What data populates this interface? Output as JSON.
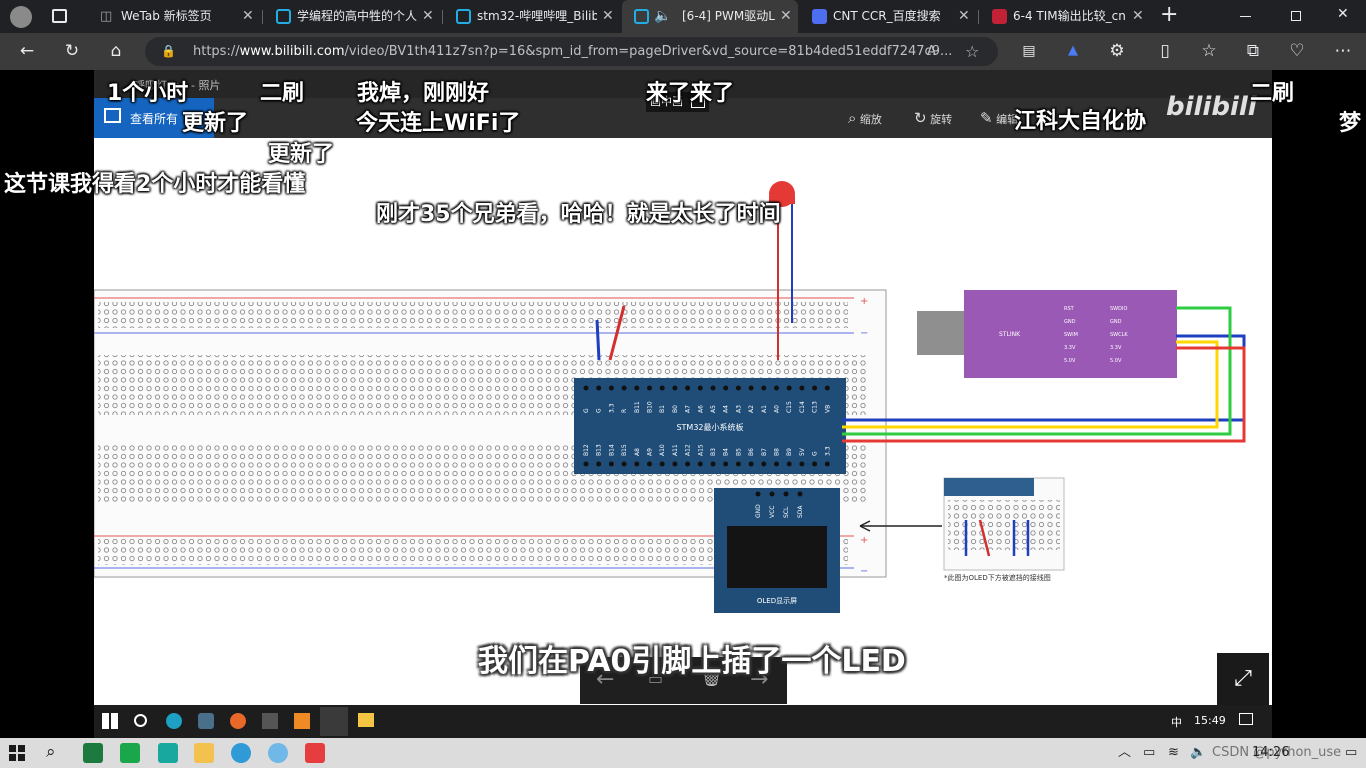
{
  "browser": {
    "tabs": [
      {
        "title": "WeTab 新标签页",
        "icon": "wetab-icon",
        "color": "#9aa0a6"
      },
      {
        "title": "学编程的高中牲的个人",
        "icon": "bilibili-tv-icon",
        "color": "#23ade5"
      },
      {
        "title": "stm32-哔哩哔哩_Bilib",
        "icon": "bilibili-tv-icon",
        "color": "#23ade5"
      },
      {
        "title": "[6-4] PWM驱动L",
        "icon": "bilibili-tv-icon",
        "color": "#23ade5"
      },
      {
        "title": "CNT CCR_百度搜索",
        "icon": "baidu-icon",
        "color": "#4e6ef2"
      },
      {
        "title": "6-4 TIM输出比较_cntc",
        "icon": "csdn-icon",
        "color": "#c32136"
      }
    ],
    "new_tab": "+",
    "url_prefix": "https://",
    "url_domain": "www.bilibili.com",
    "url_rest": "/video/BV1th411z7sn?p=16&spm_id_from=pageDriver&vd_source=81b4ded51eddf7247c9..."
  },
  "viewer": {
    "file_title": "呼吸灯.jpg - 照片",
    "view_all": "查看所有",
    "zoom": "缩放",
    "rotate": "旋转",
    "edit": "编辑",
    "pip_label": "画中画"
  },
  "danmaku": [
    "1个小时",
    "二刷",
    "我焯，刚刚好",
    "来了来了",
    "二刷",
    "更新了",
    "今天连上WiFi了",
    "江科大自化协",
    "梦",
    "更新了",
    "这节课我得看2个小时才能看懂",
    "刚才35个兄弟看，哈哈！就是太长了时间"
  ],
  "subtitle": "我们在PA0引脚上插了一个LED",
  "diagram": {
    "board_label": "STM32最小系统板",
    "oled_label": "OLED显示屏",
    "oled_pins": [
      "GND",
      "VCC",
      "SCL",
      "SDA"
    ],
    "stlink_label": "STLINK",
    "stlink_left": [
      "RST",
      "GND",
      "SWIM",
      "3.3V",
      "5.0V"
    ],
    "stlink_right": [
      "SWDIO",
      "GND",
      "SWCLK",
      "3.3V",
      "5.0V"
    ],
    "top_pins": [
      "G",
      "G",
      "3.3",
      "R",
      "B11",
      "B10",
      "B1",
      "B0",
      "A7",
      "A6",
      "A5",
      "A4",
      "A3",
      "A2",
      "A1",
      "A0",
      "C15",
      "C14",
      "C13",
      "VB"
    ],
    "bottom_pins": [
      "B12",
      "B13",
      "B14",
      "B15",
      "A8",
      "A9",
      "A10",
      "A11",
      "A12",
      "A15",
      "B3",
      "B4",
      "B5",
      "B6",
      "B7",
      "B8",
      "B9",
      "5V",
      "G",
      "3.3"
    ],
    "note": "*此图为OLED下方被遮挡的接线图"
  },
  "inner_taskbar": {
    "time": "15:49",
    "ime": "中"
  },
  "watermark": "CSDN @python_use",
  "taskbar": {
    "time": "14:26"
  }
}
